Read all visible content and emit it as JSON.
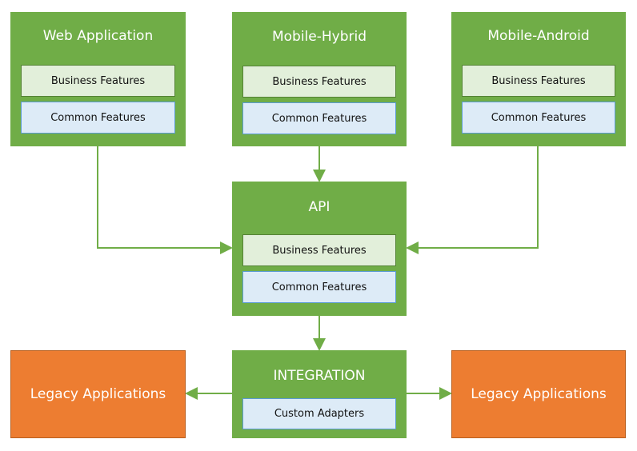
{
  "colors": {
    "layer": "#70ad47",
    "business": "#e2efda",
    "common": "#ddebf7",
    "legacy": "#ed7d31",
    "connector": "#70ad47"
  },
  "web": {
    "title": "Web Application",
    "business": "Business Features",
    "common": "Common Features"
  },
  "hybrid": {
    "title": "Mobile-Hybrid",
    "business": "Business Features",
    "common": "Common Features"
  },
  "android": {
    "title": "Mobile-Android",
    "business": "Business Features",
    "common": "Common Features"
  },
  "api": {
    "title": "API",
    "business": "Business Features",
    "common": "Common Features"
  },
  "integration": {
    "title": "INTEGRATION",
    "adapters": "Custom Adapters"
  },
  "legacy_left": {
    "label": "Legacy Applications"
  },
  "legacy_right": {
    "label": "Legacy Applications"
  }
}
